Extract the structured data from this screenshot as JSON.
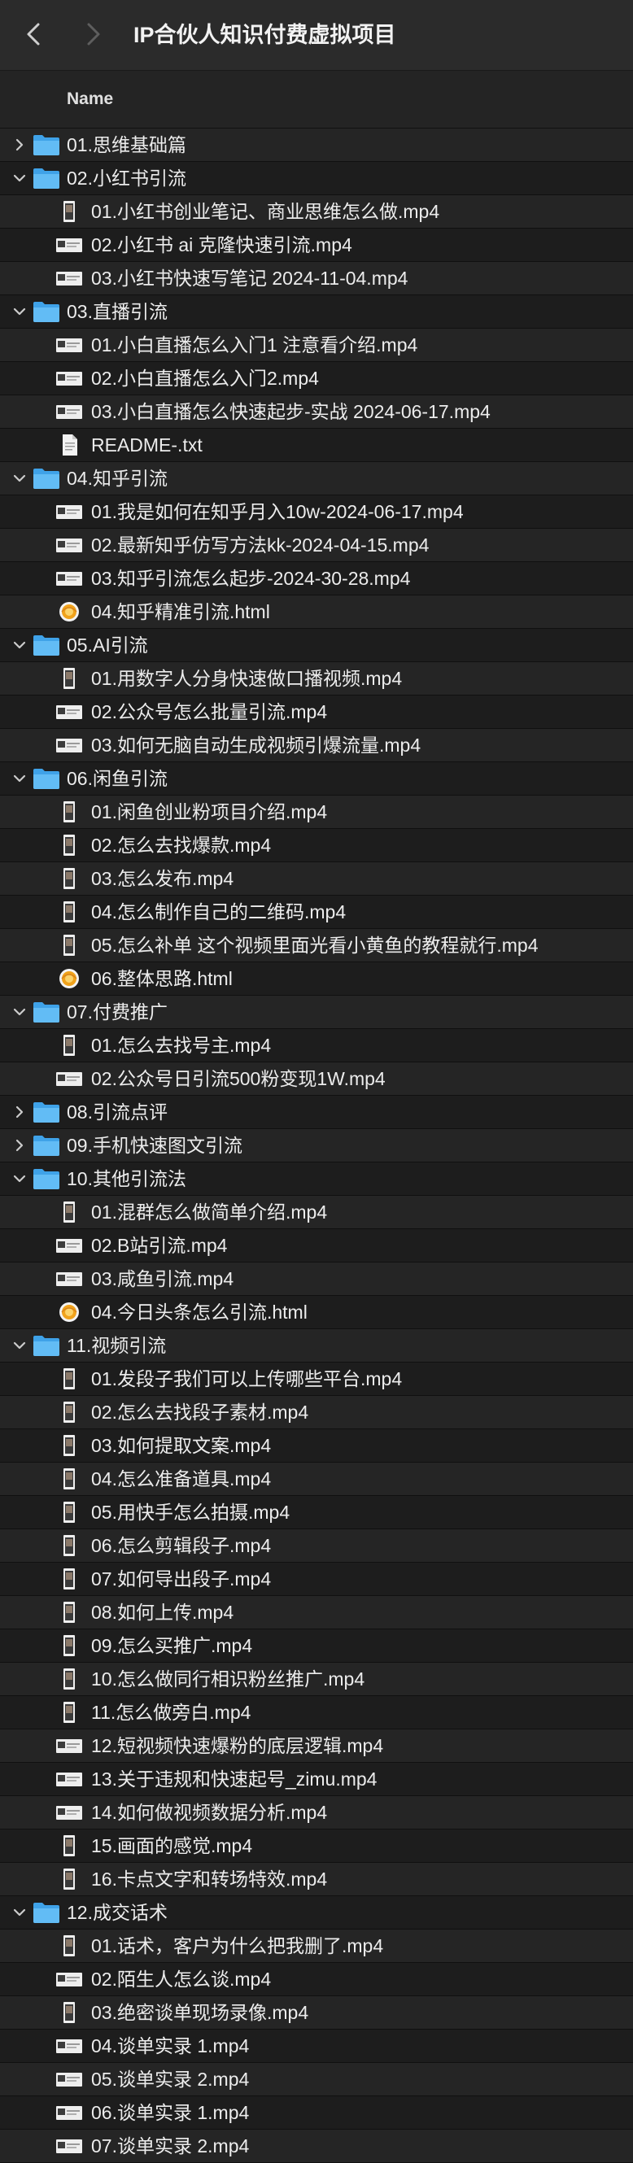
{
  "window": {
    "title": "IP合伙人知识付费虚拟项目"
  },
  "column": {
    "name": "Name"
  },
  "items": [
    {
      "type": "folder",
      "expanded": false,
      "label": "01.思维基础篇",
      "icon": "folder-icon"
    },
    {
      "type": "folder",
      "expanded": true,
      "label": "02.小红书引流",
      "icon": "folder-icon"
    },
    {
      "type": "file",
      "label": "01.小红书创业笔记、商业思维怎么做.mp4",
      "icon": "video-portrait-icon"
    },
    {
      "type": "file",
      "label": "02.小红书 ai 克隆快速引流.mp4",
      "icon": "video-landscape-icon"
    },
    {
      "type": "file",
      "label": "03.小红书快速写笔记 2024-11-04.mp4",
      "icon": "video-landscape-icon"
    },
    {
      "type": "folder",
      "expanded": true,
      "label": "03.直播引流",
      "icon": "folder-icon"
    },
    {
      "type": "file",
      "label": "01.小白直播怎么入门1 注意看介绍.mp4",
      "icon": "video-landscape-icon"
    },
    {
      "type": "file",
      "label": "02.小白直播怎么入门2.mp4",
      "icon": "video-landscape-icon"
    },
    {
      "type": "file",
      "label": "03.小白直播怎么快速起步-实战 2024-06-17.mp4",
      "icon": "video-landscape-icon"
    },
    {
      "type": "file",
      "label": "README-.txt",
      "icon": "text-document-icon"
    },
    {
      "type": "folder",
      "expanded": true,
      "label": "04.知乎引流",
      "icon": "folder-icon"
    },
    {
      "type": "file",
      "label": "01.我是如何在知乎月入10w-2024-06-17.mp4",
      "icon": "video-landscape-icon"
    },
    {
      "type": "file",
      "label": "02.最新知乎仿写方法kk-2024-04-15.mp4",
      "icon": "video-landscape-icon"
    },
    {
      "type": "file",
      "label": "03.知乎引流怎么起步-2024-30-28.mp4",
      "icon": "video-landscape-icon"
    },
    {
      "type": "file",
      "label": "04.知乎精准引流.html",
      "icon": "html-file-icon"
    },
    {
      "type": "folder",
      "expanded": true,
      "label": "05.AI引流",
      "icon": "folder-icon"
    },
    {
      "type": "file",
      "label": "01.用数字人分身快速做口播视频.mp4",
      "icon": "video-portrait-icon"
    },
    {
      "type": "file",
      "label": "02.公众号怎么批量引流.mp4",
      "icon": "video-landscape-icon"
    },
    {
      "type": "file",
      "label": "03.如何无脑自动生成视频引爆流量.mp4",
      "icon": "video-landscape-icon"
    },
    {
      "type": "folder",
      "expanded": true,
      "label": "06.闲鱼引流",
      "icon": "folder-icon"
    },
    {
      "type": "file",
      "label": "01.闲鱼创业粉项目介绍.mp4",
      "icon": "video-portrait-icon"
    },
    {
      "type": "file",
      "label": "02.怎么去找爆款.mp4",
      "icon": "video-portrait-icon"
    },
    {
      "type": "file",
      "label": "03.怎么发布.mp4",
      "icon": "video-portrait-icon"
    },
    {
      "type": "file",
      "label": "04.怎么制作自己的二维码.mp4",
      "icon": "video-portrait-icon"
    },
    {
      "type": "file",
      "label": "05.怎么补单 这个视频里面光看小黄鱼的教程就行.mp4",
      "icon": "video-portrait-icon"
    },
    {
      "type": "file",
      "label": "06.整体思路.html",
      "icon": "html-file-icon"
    },
    {
      "type": "folder",
      "expanded": true,
      "label": "07.付费推广",
      "icon": "folder-icon"
    },
    {
      "type": "file",
      "label": "01.怎么去找号主.mp4",
      "icon": "video-portrait-icon"
    },
    {
      "type": "file",
      "label": "02.公众号日引流500粉变现1W.mp4",
      "icon": "video-landscape-icon"
    },
    {
      "type": "folder",
      "expanded": false,
      "label": "08.引流点评",
      "icon": "folder-icon"
    },
    {
      "type": "folder",
      "expanded": false,
      "label": "09.手机快速图文引流",
      "icon": "folder-icon"
    },
    {
      "type": "folder",
      "expanded": true,
      "label": "10.其他引流法",
      "icon": "folder-icon"
    },
    {
      "type": "file",
      "label": "01.混群怎么做简单介绍.mp4",
      "icon": "video-portrait-icon"
    },
    {
      "type": "file",
      "label": "02.B站引流.mp4",
      "icon": "video-landscape-icon"
    },
    {
      "type": "file",
      "label": "03.咸鱼引流.mp4",
      "icon": "video-landscape-icon"
    },
    {
      "type": "file",
      "label": "04.今日头条怎么引流.html",
      "icon": "html-file-icon"
    },
    {
      "type": "folder",
      "expanded": true,
      "label": "11.视频引流",
      "icon": "folder-icon"
    },
    {
      "type": "file",
      "label": "01.发段子我们可以上传哪些平台.mp4",
      "icon": "video-portrait-icon"
    },
    {
      "type": "file",
      "label": "02.怎么去找段子素材.mp4",
      "icon": "video-portrait-icon"
    },
    {
      "type": "file",
      "label": "03.如何提取文案.mp4",
      "icon": "video-portrait-icon"
    },
    {
      "type": "file",
      "label": "04.怎么准备道具.mp4",
      "icon": "video-portrait-icon"
    },
    {
      "type": "file",
      "label": "05.用快手怎么拍摄.mp4",
      "icon": "video-portrait-icon"
    },
    {
      "type": "file",
      "label": "06.怎么剪辑段子.mp4",
      "icon": "video-portrait-icon"
    },
    {
      "type": "file",
      "label": "07.如何导出段子.mp4",
      "icon": "video-portrait-icon"
    },
    {
      "type": "file",
      "label": "08.如何上传.mp4",
      "icon": "video-portrait-icon"
    },
    {
      "type": "file",
      "label": "09.怎么买推广.mp4",
      "icon": "video-portrait-icon"
    },
    {
      "type": "file",
      "label": "10.怎么做同行相识粉丝推广.mp4",
      "icon": "video-portrait-icon"
    },
    {
      "type": "file",
      "label": "11.怎么做旁白.mp4",
      "icon": "video-portrait-icon"
    },
    {
      "type": "file",
      "label": "12.短视频快速爆粉的底层逻辑.mp4",
      "icon": "video-landscape-icon"
    },
    {
      "type": "file",
      "label": "13.关于违规和快速起号_zimu.mp4",
      "icon": "video-landscape-icon"
    },
    {
      "type": "file",
      "label": "14.如何做视频数据分析.mp4",
      "icon": "video-landscape-icon"
    },
    {
      "type": "file",
      "label": "15.画面的感觉.mp4",
      "icon": "video-portrait-icon"
    },
    {
      "type": "file",
      "label": "16.卡点文字和转场特效.mp4",
      "icon": "video-portrait-icon"
    },
    {
      "type": "folder",
      "expanded": true,
      "label": "12.成交话术",
      "icon": "folder-icon"
    },
    {
      "type": "file",
      "label": "01.话术，客户为什么把我删了.mp4",
      "icon": "video-portrait-icon"
    },
    {
      "type": "file",
      "label": "02.陌生人怎么谈.mp4",
      "icon": "video-landscape-icon"
    },
    {
      "type": "file",
      "label": "03.绝密谈单现场录像.mp4",
      "icon": "video-portrait-icon"
    },
    {
      "type": "file",
      "label": "04.谈单实录 1.mp4",
      "icon": "video-landscape-icon"
    },
    {
      "type": "file",
      "label": "05.谈单实录 2.mp4",
      "icon": "video-landscape-icon"
    },
    {
      "type": "file",
      "label": "06.谈单实录 1.mp4",
      "icon": "video-landscape-icon"
    },
    {
      "type": "file",
      "label": "07.谈单实录 2.mp4",
      "icon": "video-landscape-icon"
    }
  ]
}
